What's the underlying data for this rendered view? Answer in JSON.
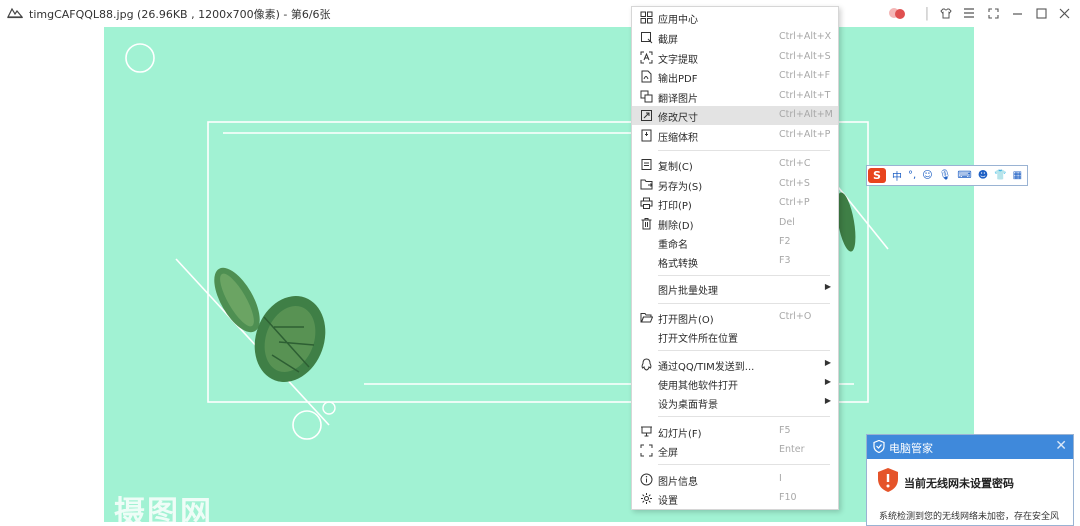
{
  "window": {
    "title": "timgCAFQQL88.jpg (26.96KB , 1200x700像素) - 第6/6张",
    "controls": [
      "shirt-icon",
      "menu-icon",
      "fullscreen-icon",
      "minimize-icon",
      "maximize-icon",
      "close-icon"
    ]
  },
  "image": {
    "background_color": "#a1f2d3",
    "watermark": "摄图网"
  },
  "context_menu": {
    "items": [
      {
        "icon": "app-center-icon",
        "label": "应用中心",
        "shortcut": ""
      },
      {
        "icon": "screenshot-icon",
        "label": "截屏",
        "shortcut": "Ctrl+Alt+X"
      },
      {
        "icon": "ocr-icon",
        "label": "文字提取",
        "shortcut": "Ctrl+Alt+S"
      },
      {
        "icon": "pdf-icon",
        "label": "输出PDF",
        "shortcut": "Ctrl+Alt+F"
      },
      {
        "icon": "translate-icon",
        "label": "翻译图片",
        "shortcut": "Ctrl+Alt+T"
      },
      {
        "icon": "resize-icon",
        "label": "修改尺寸",
        "shortcut": "Ctrl+Alt+M",
        "highlighted": true
      },
      {
        "icon": "compress-icon",
        "label": "压缩体积",
        "shortcut": "Ctrl+Alt+P"
      },
      {
        "icon": "copy-icon",
        "label": "复制(C)",
        "shortcut": "Ctrl+C"
      },
      {
        "icon": "save-as-icon",
        "label": "另存为(S)",
        "shortcut": "Ctrl+S"
      },
      {
        "icon": "print-icon",
        "label": "打印(P)",
        "shortcut": "Ctrl+P"
      },
      {
        "icon": "delete-icon",
        "label": "删除(D)",
        "shortcut": "Del"
      },
      {
        "icon": "",
        "label": "重命名",
        "shortcut": "F2"
      },
      {
        "icon": "",
        "label": "格式转换",
        "shortcut": "F3"
      },
      {
        "icon": "",
        "label": "图片批量处理",
        "shortcut": "",
        "submenu": true
      },
      {
        "icon": "open-folder-icon",
        "label": "打开图片(O)",
        "shortcut": "Ctrl+O"
      },
      {
        "icon": "",
        "label": "打开文件所在位置",
        "shortcut": ""
      },
      {
        "icon": "qq-icon",
        "label": "通过QQ/TIM发送到...",
        "shortcut": "",
        "submenu": true
      },
      {
        "icon": "",
        "label": "使用其他软件打开",
        "shortcut": "",
        "submenu": true
      },
      {
        "icon": "",
        "label": "设为桌面背景",
        "shortcut": "",
        "submenu": true
      },
      {
        "icon": "slideshow-icon",
        "label": "幻灯片(F)",
        "shortcut": "F5"
      },
      {
        "icon": "fullscreen-icon",
        "label": "全屏",
        "shortcut": "Enter"
      },
      {
        "icon": "info-icon",
        "label": "图片信息",
        "shortcut": "I"
      },
      {
        "icon": "settings-icon",
        "label": "设置",
        "shortcut": "F10"
      }
    ]
  },
  "ime_toolbar": {
    "mode": "中",
    "punct": "°,",
    "icons": [
      "emoji-icon",
      "mic-icon",
      "keyboard-icon",
      "user-icon",
      "skin-icon",
      "toolbox-icon"
    ]
  },
  "toast": {
    "app_name": "电脑管家",
    "headline": "当前无线网未设置密码",
    "body": "系统检测到您的无线网络未加密，存在安全风"
  }
}
